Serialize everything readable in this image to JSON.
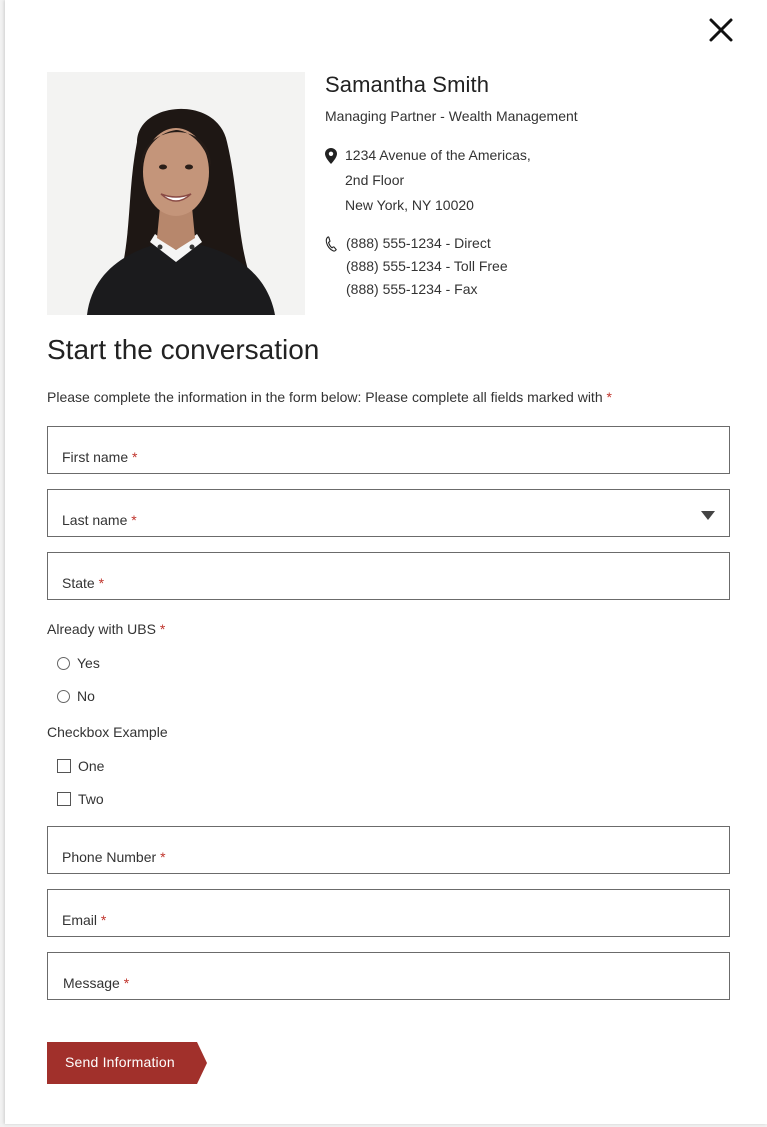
{
  "advisor": {
    "name": "Samantha Smith",
    "title": "Managing Partner - Wealth Management",
    "address": [
      "1234 Avenue of the Americas,",
      "2nd Floor",
      "New York, NY 10020"
    ],
    "phones": [
      "(888) 555-1234 - Direct",
      "(888) 555-1234 - Toll Free",
      "(888) 555-1234 - Fax"
    ]
  },
  "form": {
    "heading": "Start the conversation",
    "intro": "Please complete the information in the form below: Please complete all fields marked with",
    "required_marker": "*",
    "fields": {
      "first_name": "First name",
      "last_name": "Last name",
      "state": "State",
      "phone": "Phone Number",
      "email": "Email",
      "message": "Message"
    },
    "already_with_ubs": {
      "label": "Already with UBS",
      "options": [
        "Yes",
        "No"
      ]
    },
    "checkbox_example": {
      "label": "Checkbox Example",
      "options": [
        "One",
        "Two"
      ]
    },
    "submit_label": "Send Information"
  },
  "icons": {
    "close": "close-icon",
    "address": "map-pin-icon",
    "phone": "phone-icon",
    "dropdown": "caret-down-icon"
  },
  "colors": {
    "accent": "#a1302b",
    "required": "#c0342c",
    "border": "#6b6b6b"
  }
}
